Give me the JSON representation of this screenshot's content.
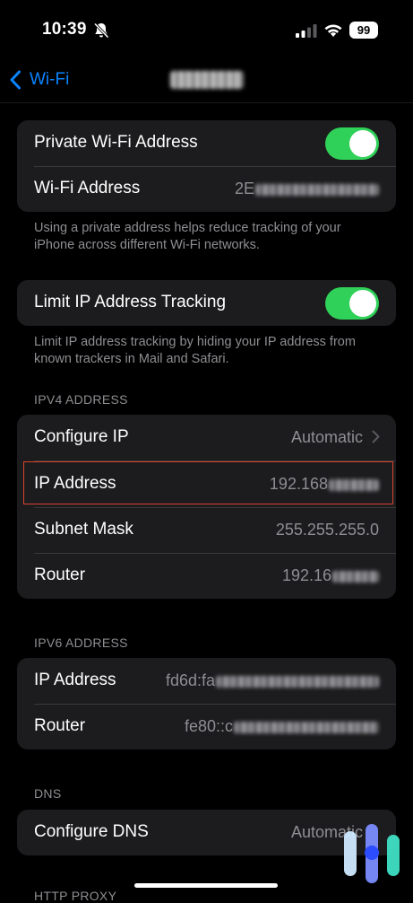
{
  "status": {
    "time": "10:39",
    "battery": "99"
  },
  "nav": {
    "back_label": "Wi-Fi"
  },
  "private_group": {
    "private_label": "Private Wi-Fi Address",
    "private_on": true,
    "wifi_address_label": "Wi-Fi Address",
    "wifi_address_value": "2E"
  },
  "private_footer": "Using a private address helps reduce tracking of your iPhone across different Wi-Fi networks.",
  "limit_group": {
    "label": "Limit IP Address Tracking",
    "on": true
  },
  "limit_footer": "Limit IP address tracking by hiding your IP address from known trackers in Mail and Safari.",
  "ipv4": {
    "header": "IPV4 ADDRESS",
    "configure_label": "Configure IP",
    "configure_value": "Automatic",
    "ip_label": "IP Address",
    "ip_value": "192.168",
    "subnet_label": "Subnet Mask",
    "subnet_value": "255.255.255.0",
    "router_label": "Router",
    "router_value": "192.16"
  },
  "ipv6": {
    "header": "IPV6 ADDRESS",
    "ip_label": "IP Address",
    "ip_value": "fd6d:fa",
    "router_label": "Router",
    "router_value": "fe80::c"
  },
  "dns": {
    "header": "DNS",
    "configure_label": "Configure DNS",
    "configure_value": "Automatic"
  },
  "next_header": "HTTP PROXY",
  "colors": {
    "accent": "#0a84ff",
    "toggle_on": "#30d158",
    "highlight": "#d9442c"
  }
}
